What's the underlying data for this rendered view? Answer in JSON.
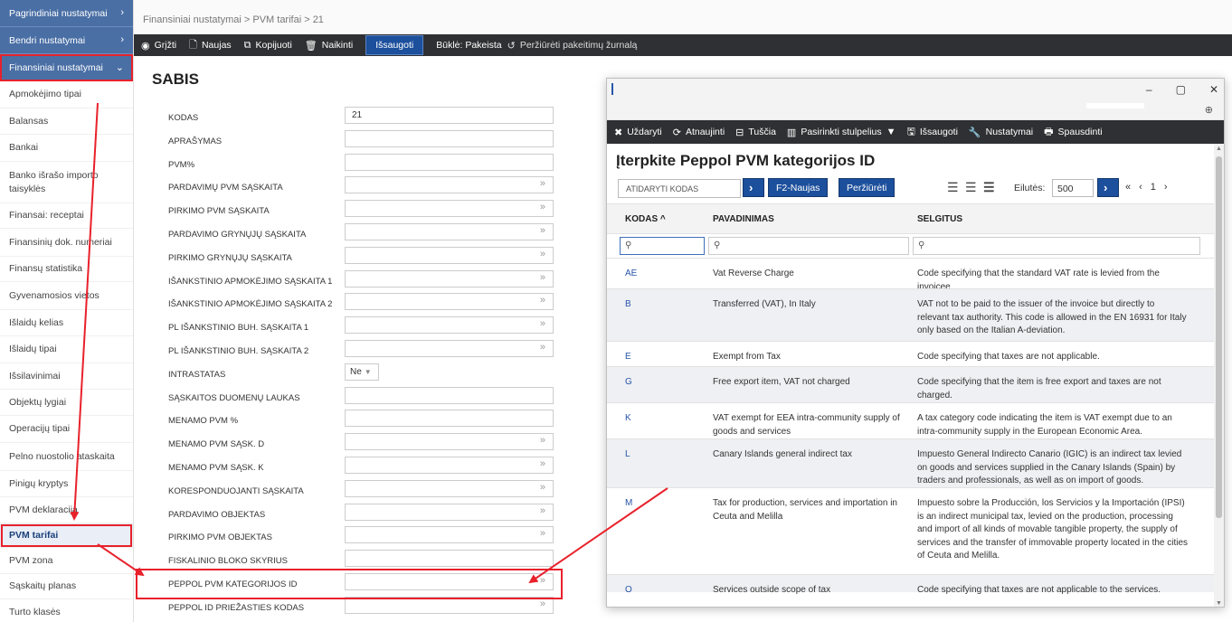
{
  "sidebar": {
    "top": [
      {
        "label": "Pagrindiniai nustatymai",
        "chev": "›"
      },
      {
        "label": "Bendri nustatymai",
        "chev": "›"
      },
      {
        "label": "Finansiniai nustatymai",
        "chev": "⌄"
      }
    ],
    "items": [
      "Apmokėjimo tipai",
      "Balansas",
      "Bankai",
      "Banko išrašo importo taisyklės",
      "Finansai: receptai",
      "Finansinių dok. numeriai",
      "Finansų statistika",
      "Gyvenamosios vietos",
      "Išlaidų kelias",
      "Išlaidų tipai",
      "Išsilavinimai",
      "Objektų lygiai",
      "Operacijų tipai",
      "Pelno nuostolio ataskaita",
      "Pinigų kryptys",
      "PVM deklaracija",
      "PVM tarifai",
      "PVM zona",
      "Sąskaitų planas",
      "Turto klasės"
    ]
  },
  "breadcrumb": "Finansiniai nustatymai > PVM tarifai > 21",
  "toolbar": {
    "back": "Grįžti",
    "new": "Naujas",
    "copy": "Kopijuoti",
    "delete": "Naikinti",
    "save": "Išsaugoti",
    "state": "Būklė: Pakeista",
    "log": "Peržiūrėti pakeitimų žurnalą"
  },
  "form": {
    "title": "SABIS",
    "fields": [
      {
        "label": "KODAS",
        "value": "21"
      },
      {
        "label": "APRAŠYMAS",
        "value": ""
      },
      {
        "label": "PVM%",
        "value": ""
      },
      {
        "label": "PARDAVIMŲ PVM SĄSKAITA",
        "value": ""
      },
      {
        "label": "PIRKIMO PVM SĄSKAITA",
        "value": ""
      },
      {
        "label": "PARDAVIMO GRYNŲJŲ SĄSKAITA",
        "value": ""
      },
      {
        "label": "PIRKIMO GRYNŲJŲ SĄSKAITA",
        "value": ""
      },
      {
        "label": "IŠANKSTINIO APMOKĖJIMO SĄSKAITA 1",
        "value": ""
      },
      {
        "label": "IŠANKSTINIO APMOKĖJIMO SĄSKAITA 2",
        "value": ""
      },
      {
        "label": "PL IŠANKSTINIO BUH. SĄSKAITA 1",
        "value": ""
      },
      {
        "label": "PL IŠANKSTINIO BUH. SĄSKAITA 2",
        "value": ""
      },
      {
        "label": "INTRASTATAS",
        "value": "Ne"
      },
      {
        "label": "SĄSKAITOS DUOMENŲ LAUKAS",
        "value": ""
      },
      {
        "label": "MENAMO PVM %",
        "value": ""
      },
      {
        "label": "MENAMO PVM SĄSK. D",
        "value": ""
      },
      {
        "label": "MENAMO PVM SĄSK. K",
        "value": ""
      },
      {
        "label": "KORESPONDUOJANTI SĄSKAITA",
        "value": ""
      },
      {
        "label": "PARDAVIMO OBJEKTAS",
        "value": ""
      },
      {
        "label": "PIRKIMO PVM OBJEKTAS",
        "value": ""
      },
      {
        "label": "FISKALINIO BLOKO SKYRIUS",
        "value": ""
      },
      {
        "label": "PEPPOL PVM KATEGORIJOS ID",
        "value": ""
      },
      {
        "label": "PEPPOL ID PRIEŽASTIES KODAS",
        "value": ""
      }
    ],
    "picker_glyph": "»",
    "select_caret": "▼"
  },
  "modal": {
    "toolbar": {
      "close": "Uždaryti",
      "refresh": "Atnaujinti",
      "clear": "Tuščia",
      "columns": "Pasirinkti stulpelius",
      "save": "Išsaugoti",
      "settings": "Nustatymai",
      "print": "Spausdinti"
    },
    "title": "Įterpkite Peppol PVM kategorijos ID",
    "filter_placeholder": "ATIDARYTI Kodas",
    "go": "›",
    "f2_new": "F2-Naujas",
    "preview": "Peržiūrėti",
    "rows_label": "Eilutės:",
    "rows_value": "500",
    "pager": {
      "first": "«",
      "prev": "‹",
      "page": "1",
      "next": "›"
    },
    "columns": [
      "KODAS ^",
      "PAVADINIMAS",
      "SELGITUS"
    ],
    "search_icon": "⚲",
    "rows": [
      {
        "code": "AE",
        "name": "Vat Reverse Charge",
        "desc": "Code specifying that the standard VAT rate is levied from the invoicee."
      },
      {
        "code": "B",
        "name": "Transferred (VAT), In Italy",
        "desc": "VAT not to be paid to the issuer of the invoice but directly to relevant tax authority. This code is allowed in the EN 16931 for Italy only based on the Italian A-deviation."
      },
      {
        "code": "E",
        "name": "Exempt from Tax",
        "desc": "Code specifying that taxes are not applicable."
      },
      {
        "code": "G",
        "name": "Free export item, VAT not charged",
        "desc": "Code specifying that the item is free export and taxes are not charged."
      },
      {
        "code": "K",
        "name": "VAT exempt for EEA intra-community supply of goods and services",
        "desc": "A tax category code indicating the item is VAT exempt due to an intra-community supply in the European Economic Area."
      },
      {
        "code": "L",
        "name": "Canary Islands general indirect tax",
        "desc": "Impuesto General Indirecto Canario (IGIC) is an indirect tax levied on goods and services supplied in the Canary Islands (Spain) by traders and professionals, as well as on import of goods."
      },
      {
        "code": "M",
        "name": "Tax for production, services and importation in Ceuta and Melilla",
        "desc": "Impuesto sobre la Producción, los Servicios y la Importación (IPSI) is an indirect municipal tax, levied on the production, processing and import of all kinds of movable tangible property, the supply of services and the transfer of immovable property located in the cities of Ceuta and Melilla."
      },
      {
        "code": "O",
        "name": "Services outside scope of tax",
        "desc": "Code specifying that taxes are not applicable to the services."
      }
    ]
  },
  "colors": {
    "accent": "#1c4f9c",
    "highlight": "#e8212b",
    "toolbar": "#2e3033",
    "sidebar_header": "#4a6fa5"
  }
}
